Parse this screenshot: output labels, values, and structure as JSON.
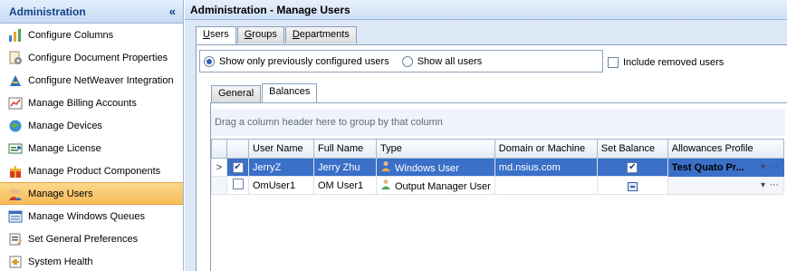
{
  "nav": {
    "title": "Administration",
    "collapse_glyph": "«",
    "items": [
      {
        "label": "Configure Columns",
        "icon": "columns-icon"
      },
      {
        "label": "Configure Document Properties",
        "icon": "document-properties-icon"
      },
      {
        "label": "Configure NetWeaver Integration",
        "icon": "netweaver-icon"
      },
      {
        "label": "Manage Billing Accounts",
        "icon": "billing-icon"
      },
      {
        "label": "Manage Devices",
        "icon": "devices-icon"
      },
      {
        "label": "Manage License",
        "icon": "license-icon"
      },
      {
        "label": "Manage Product Components",
        "icon": "components-icon"
      },
      {
        "label": "Manage Users",
        "icon": "users-icon",
        "selected": true
      },
      {
        "label": "Manage Windows Queues",
        "icon": "queues-icon"
      },
      {
        "label": "Set General Preferences",
        "icon": "preferences-icon"
      },
      {
        "label": "System Health",
        "icon": "health-icon"
      }
    ]
  },
  "content": {
    "title": "Administration - Manage Users",
    "tabs": [
      {
        "first": "U",
        "rest": "sers",
        "active": true
      },
      {
        "first": "G",
        "rest": "roups"
      },
      {
        "first": "D",
        "rest": "epartments"
      }
    ],
    "filter": {
      "option1": "Show only previously configured users",
      "option2": "Show all users",
      "include_removed": "Include removed users"
    },
    "subtabs": [
      "General",
      "Balances"
    ],
    "group_hint": "Drag a column header here to group by that column",
    "columns": [
      "User Name",
      "Full Name",
      "Type",
      "Domain or Machine",
      "Set Balance",
      "Allowances Profile"
    ],
    "rows": [
      {
        "user": "JerryZ",
        "full": "Jerry Zhu",
        "type": "Windows User",
        "domain": "md.nsius.com",
        "checked": true,
        "set_balance": true,
        "profile": "Test Quato Pr...",
        "selected": true
      },
      {
        "user": "OmUser1",
        "full": "OM User1",
        "type": "Output Manager User",
        "domain": "",
        "checked": false,
        "set_balance": false,
        "profile": "",
        "selected": false
      }
    ],
    "row_indicator": ">",
    "profile_controls": "▾ ⋯"
  },
  "colors": {
    "accent": "#15428b",
    "selection": "#3a70c8",
    "nav_selected": "#f7bb58"
  }
}
